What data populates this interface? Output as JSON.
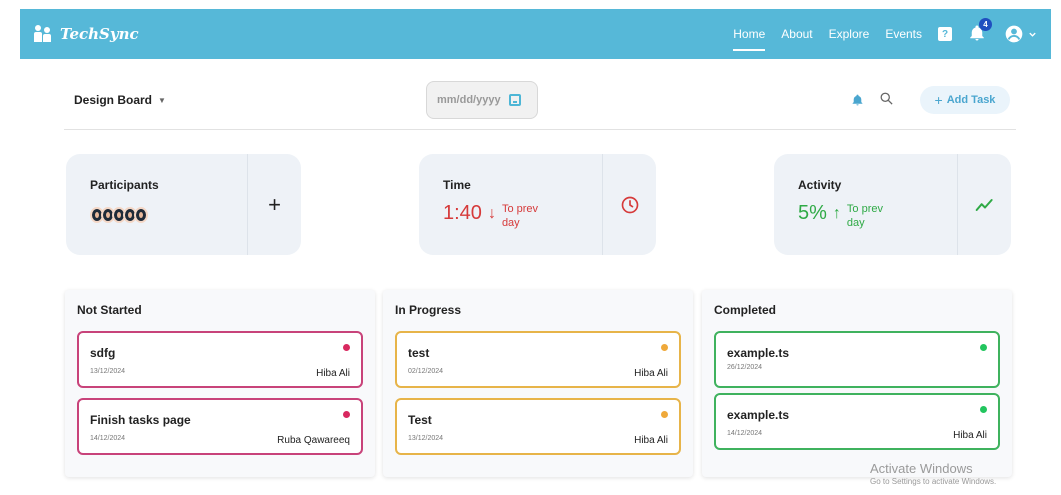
{
  "navbar": {
    "brand": "TechSync",
    "links": [
      "Home",
      "About",
      "Explore",
      "Events"
    ],
    "active_link": "Home",
    "help_label": "?",
    "notification_count": "4",
    "accent_color": "#56b8d8"
  },
  "toolbar": {
    "board_label": "Design Board",
    "date_placeholder": "mm/dd/yyyy",
    "add_task_label": "Add Task"
  },
  "stats": {
    "participants": {
      "title": "Participants"
    },
    "time": {
      "title": "Time",
      "value": "1:40",
      "note": "To prev day",
      "trend": "down"
    },
    "activity": {
      "title": "Activity",
      "value": "5%",
      "note": "To prev day",
      "trend": "up"
    }
  },
  "columns": [
    {
      "title": "Not Started",
      "tasks": [
        {
          "title": "sdfg",
          "date": "13/12/2024",
          "assignee": "Hiba Ali"
        },
        {
          "title": "Finish tasks page",
          "date": "14/12/2024",
          "assignee": "Ruba Qawareeq"
        }
      ]
    },
    {
      "title": "In Progress",
      "tasks": [
        {
          "title": "test",
          "date": "02/12/2024",
          "assignee": "Hiba Ali"
        },
        {
          "title": "Test",
          "date": "13/12/2024",
          "assignee": "Hiba Ali"
        }
      ]
    },
    {
      "title": "Completed",
      "tasks": [
        {
          "title": "example.ts",
          "date": "26/12/2024",
          "assignee": ""
        },
        {
          "title": "example.ts",
          "date": "14/12/2024",
          "assignee": "Hiba Ali"
        }
      ]
    }
  ],
  "watermark": {
    "line1": "Activate Windows",
    "line2": "Go to Settings to activate Windows."
  }
}
